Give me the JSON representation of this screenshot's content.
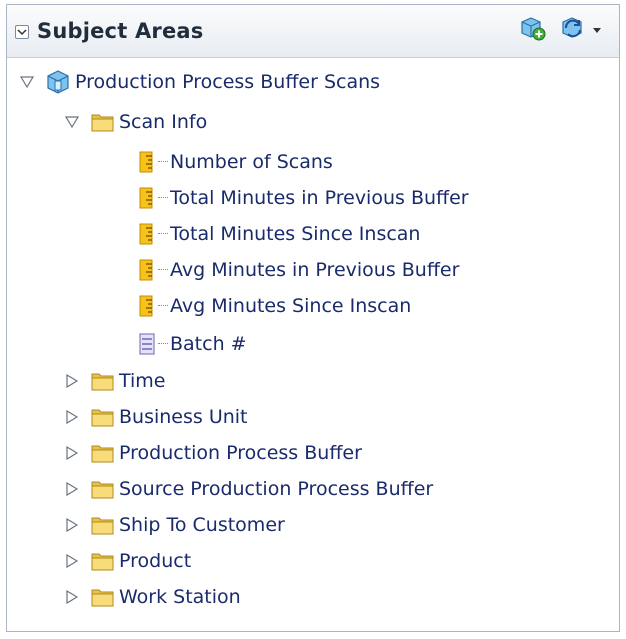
{
  "header": {
    "title": "Subject Areas",
    "collapse_icon": "chevron-down-icon",
    "add_icon": "add-subject-area-icon",
    "refresh_icon": "refresh-icon",
    "menu_icon": "dropdown-arrow-icon"
  },
  "tree": {
    "root": {
      "label": "Production Process Buffer Scans",
      "expanded": true,
      "icon": "subject-area-icon"
    },
    "scan_info": {
      "label": "Scan Info",
      "expanded": true,
      "icon": "folder-icon"
    },
    "measures": [
      {
        "label": "Number of Scans",
        "icon": "measure-icon"
      },
      {
        "label": "Total Minutes in Previous Buffer",
        "icon": "measure-icon"
      },
      {
        "label": "Total Minutes Since Inscan",
        "icon": "measure-icon"
      },
      {
        "label": "Avg Minutes in Previous Buffer",
        "icon": "measure-icon"
      },
      {
        "label": "Avg Minutes Since Inscan",
        "icon": "measure-icon"
      }
    ],
    "attribute": {
      "label": "Batch #",
      "icon": "attribute-icon"
    },
    "folders": [
      {
        "label": "Time",
        "expanded": false
      },
      {
        "label": "Business Unit",
        "expanded": false
      },
      {
        "label": "Production Process Buffer",
        "expanded": false
      },
      {
        "label": "Source Production Process Buffer",
        "expanded": false
      },
      {
        "label": "Ship To Customer",
        "expanded": false
      },
      {
        "label": "Product",
        "expanded": false
      },
      {
        "label": "Work Station",
        "expanded": false
      }
    ]
  },
  "colors": {
    "text": "#1a2b6b",
    "folder": "#f2d36b",
    "measure": "#f0b81a",
    "attribute": "#8a86c9"
  }
}
